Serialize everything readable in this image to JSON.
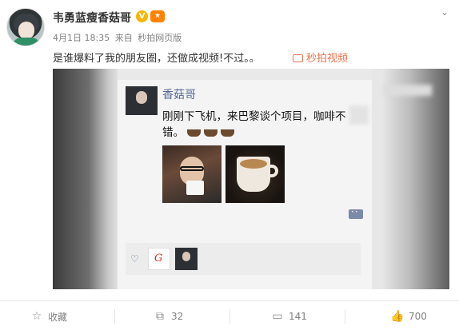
{
  "post": {
    "author": "韦勇蓝瘦香菇哥",
    "date": "4月1日 18:35",
    "source_prefix": "来自",
    "source": "秒拍网页版",
    "text": "是谁爆料了我的朋友圈，还做成视频!不过。。",
    "video_link": "秒拍视频"
  },
  "moments": {
    "name": "香菇哥",
    "line1": "刚刚下飞机，来巴黎谈个项目，咖啡不",
    "line2": "错。"
  },
  "actions": {
    "favorite_label": "收藏",
    "repost_count": "32",
    "comment_count": "141",
    "like_count": "700"
  },
  "colors": {
    "link": "#eb7350",
    "badge": "#f7b500",
    "wechat_name": "#576b95"
  },
  "icons": [
    "verified-badge-icon",
    "fans-badge-icon",
    "chevron-down-icon",
    "video-camera-icon",
    "coffee-icon",
    "comment-bubble-icon",
    "heart-icon",
    "star-icon",
    "repost-icon",
    "comment-icon",
    "thumbs-up-icon"
  ]
}
